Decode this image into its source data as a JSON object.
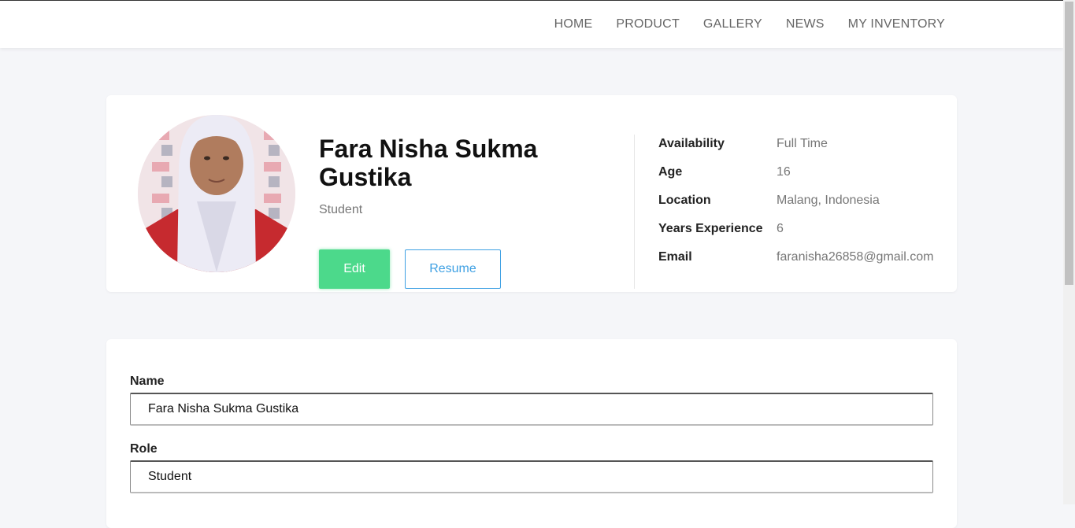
{
  "nav": {
    "items": [
      "HOME",
      "PRODUCT",
      "GALLERY",
      "NEWS",
      "MY INVENTORY"
    ]
  },
  "profile": {
    "name": "Fara Nisha Sukma Gustika",
    "role": "Student",
    "edit_label": "Edit",
    "resume_label": "Resume",
    "details": [
      {
        "label": "Availability",
        "value": "Full Time"
      },
      {
        "label": "Age",
        "value": "16"
      },
      {
        "label": "Location",
        "value": "Malang, Indonesia"
      },
      {
        "label": "Years Experience",
        "value": "6"
      },
      {
        "label": "Email",
        "value": "faranisha26858@gmail.com"
      }
    ]
  },
  "form": {
    "name_label": "Name",
    "name_value": "Fara Nisha Sukma Gustika",
    "role_label": "Role",
    "role_value": "Student"
  },
  "colors": {
    "edit_button": "#4cd98b",
    "resume_accent": "#3ea0e3",
    "page_background": "#f5f6f9"
  }
}
